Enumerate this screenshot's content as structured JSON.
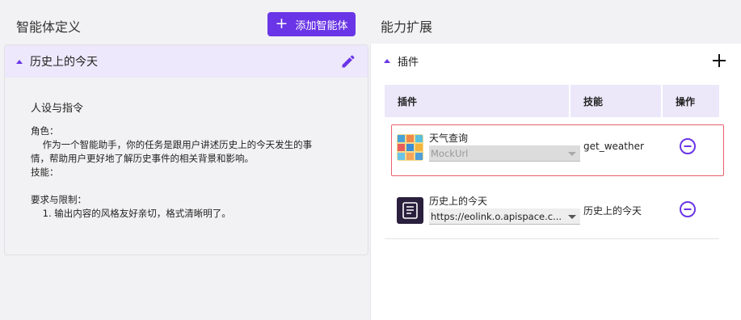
{
  "left": {
    "title": "智能体定义",
    "add_button_label": "添加智能体",
    "agent_name": "历史上的今天",
    "persona_title": "人设与指令",
    "prompt_text": "角色：\n    作为一个智能助手，你的任务是跟用户讲述历史上的今天发生的事\n情，帮助用户更好地了解历史事件的相关背景和影响。\n技能：\n\n要求与限制：\n    1. 输出内容的风格友好亲切，格式清晰明了。"
  },
  "right": {
    "title": "能力扩展",
    "section_label": "插件",
    "table": {
      "headers": [
        "插件",
        "技能",
        "操作"
      ],
      "rows": [
        {
          "name": "天气查询",
          "select_value": "MockUrl",
          "skill": "get_weather",
          "disabled": true,
          "highlighted": true,
          "icon": "weather-thumbnail-icon"
        },
        {
          "name": "历史上的今天",
          "select_value": "https://eolink.o.apispace.c...",
          "skill": "历史上的今天",
          "disabled": false,
          "highlighted": false,
          "icon": "history-plugin-icon"
        }
      ]
    }
  },
  "colors": {
    "accent": "#6a35e6",
    "header_bg": "#ede8fb",
    "highlight_border": "#e8606e"
  }
}
